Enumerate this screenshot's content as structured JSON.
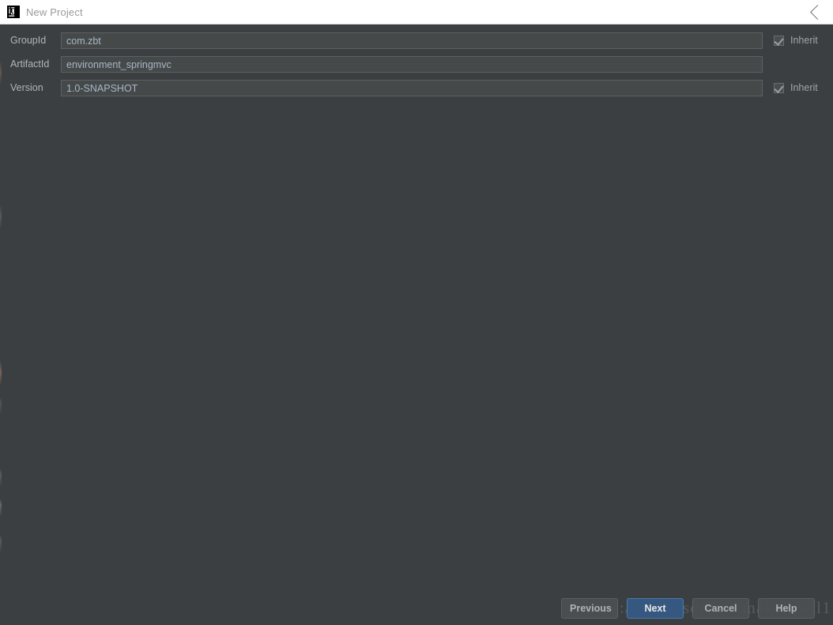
{
  "window": {
    "title": "New Project",
    "app_icon": "intellij-idea-icon",
    "close_icon": "close-icon",
    "background_color": "#3c3f41",
    "titlebar_color": "#ffffff"
  },
  "form": {
    "fields": [
      {
        "label": "GroupId",
        "value": "com.zbt",
        "placeholder": "",
        "has_inherit": true,
        "inherit_label": "Inherit",
        "inherit_checked": true
      },
      {
        "label": "ArtifactId",
        "value": "environment_springmvc",
        "placeholder": "",
        "has_inherit": false,
        "inherit_label": "",
        "inherit_checked": false
      },
      {
        "label": "Version",
        "value": "1.0-SNAPSHOT",
        "placeholder": "",
        "has_inherit": true,
        "inherit_label": "Inherit",
        "inherit_checked": true
      }
    ]
  },
  "buttons": {
    "previous": "Previous",
    "next": "Next",
    "cancel": "Cancel",
    "help": "Help",
    "default_button": "Next",
    "default_color": "#365880"
  },
  "watermark": {
    "text": "https://blog.csdn.net/makeitpeil1"
  }
}
